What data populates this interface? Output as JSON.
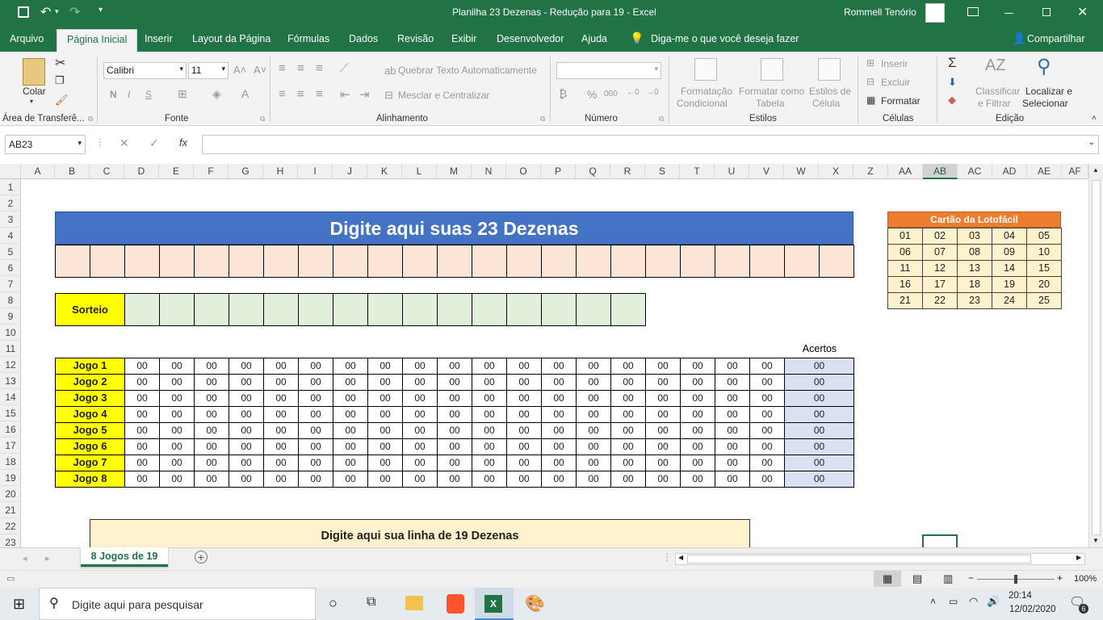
{
  "title": {
    "document": "Planilha 23 Dezenas - Redução para 19  -  Excel",
    "user": "Rommell Tenório"
  },
  "tabs": [
    "Arquivo",
    "Página Inicial",
    "Inserir",
    "Layout da Página",
    "Fórmulas",
    "Dados",
    "Revisão",
    "Exibir",
    "Desenvolvedor",
    "Ajuda"
  ],
  "tellme": "Diga-me o que você deseja fazer",
  "share": "Compartilhar",
  "ribbon": {
    "paste": "Colar",
    "clipboard": "Área de Transferê...",
    "font_name": "Calibri",
    "font_size": "11",
    "bold": "N",
    "italic": "I",
    "underline": "S",
    "font": "Fonte",
    "wrap": "Quebrar Texto Automaticamente",
    "merge": "Mesclar e Centralizar",
    "alignment": "Alinhamento",
    "number": "Número",
    "percent": "%",
    "thousands": "000",
    "cond_format": [
      "Formatação",
      "Condicional"
    ],
    "format_table": [
      "Formatar como",
      "Tabela"
    ],
    "cell_styles": [
      "Estilos de",
      "Célula"
    ],
    "styles": "Estilos",
    "insert": "Inserir",
    "delete": "Excluir",
    "format": "Formatar",
    "cells": "Células",
    "sort": [
      "Classificar",
      "e Filtrar"
    ],
    "find": [
      "Localizar e",
      "Selecionar"
    ],
    "editing": "Edição"
  },
  "namebox": "AB23",
  "columns": [
    "A",
    "B",
    "C",
    "D",
    "E",
    "F",
    "G",
    "H",
    "I",
    "J",
    "K",
    "L",
    "M",
    "N",
    "O",
    "P",
    "Q",
    "R",
    "S",
    "T",
    "U",
    "V",
    "W",
    "X",
    "Z",
    "AA",
    "AB",
    "AC",
    "AD",
    "AE",
    "AF"
  ],
  "rows": [
    "1",
    "2",
    "3",
    "4",
    "5",
    "6",
    "7",
    "8",
    "9",
    "10",
    "11",
    "12",
    "13",
    "14",
    "15",
    "16",
    "17",
    "18",
    "19",
    "20",
    "21",
    "22",
    "23"
  ],
  "sheet": {
    "header_title": "Digite aqui suas 23 Dezenas",
    "sorteio": "Sorteio",
    "acertos_label": "Acertos",
    "games": [
      {
        "label": "Jogo 1",
        "numbers": [
          "00",
          "00",
          "00",
          "00",
          "00",
          "00",
          "00",
          "00",
          "00",
          "00",
          "00",
          "00",
          "00",
          "00",
          "00",
          "00",
          "00",
          "00",
          "00"
        ],
        "hits": "00"
      },
      {
        "label": "Jogo 2",
        "numbers": [
          "00",
          "00",
          "00",
          "00",
          "00",
          "00",
          "00",
          "00",
          "00",
          "00",
          "00",
          "00",
          "00",
          "00",
          "00",
          "00",
          "00",
          "00",
          "00"
        ],
        "hits": "00"
      },
      {
        "label": "Jogo 3",
        "numbers": [
          "00",
          "00",
          "00",
          "00",
          "00",
          "00",
          "00",
          "00",
          "00",
          "00",
          "00",
          "00",
          "00",
          "00",
          "00",
          "00",
          "00",
          "00",
          "00"
        ],
        "hits": "00"
      },
      {
        "label": "Jogo 4",
        "numbers": [
          "00",
          "00",
          "00",
          "00",
          "00",
          "00",
          "00",
          "00",
          "00",
          "00",
          "00",
          "00",
          "00",
          "00",
          "00",
          "00",
          "00",
          "00",
          "00"
        ],
        "hits": "00"
      },
      {
        "label": "Jogo 5",
        "numbers": [
          "00",
          "00",
          "00",
          "00",
          "00",
          "00",
          "00",
          "00",
          "00",
          "00",
          "00",
          "00",
          "00",
          "00",
          "00",
          "00",
          "00",
          "00",
          "00"
        ],
        "hits": "00"
      },
      {
        "label": "Jogo 6",
        "numbers": [
          "00",
          "00",
          "00",
          "00",
          "00",
          "00",
          "00",
          "00",
          "00",
          "00",
          "00",
          "00",
          "00",
          "00",
          "00",
          "00",
          "00",
          "00",
          "00"
        ],
        "hits": "00"
      },
      {
        "label": "Jogo 7",
        "numbers": [
          "00",
          "00",
          "00",
          "00",
          "00",
          "00",
          "00",
          "00",
          "00",
          "00",
          "00",
          "00",
          "00",
          "00",
          "00",
          "00",
          "00",
          "00",
          "00"
        ],
        "hits": "00"
      },
      {
        "label": "Jogo 8",
        "numbers": [
          "00",
          "00",
          "00",
          "00",
          "00",
          "00",
          "00",
          "00",
          "00",
          "00",
          "00",
          "00",
          "00",
          "00",
          "00",
          "00",
          "00",
          "00",
          "00"
        ],
        "hits": "00"
      }
    ],
    "card_title": "Cartão da Lotofácil",
    "card_numbers": [
      [
        "01",
        "02",
        "03",
        "04",
        "05"
      ],
      [
        "06",
        "07",
        "08",
        "09",
        "10"
      ],
      [
        "11",
        "12",
        "13",
        "14",
        "15"
      ],
      [
        "16",
        "17",
        "18",
        "19",
        "20"
      ],
      [
        "21",
        "22",
        "23",
        "24",
        "25"
      ]
    ],
    "line19_title": "Digite aqui sua linha de 19 Dezenas"
  },
  "sheet_tab": "8 Jogos de 19",
  "zoom": "100%",
  "taskbar": {
    "search": "Digite aqui para pesquisar",
    "time": "20:14",
    "date": "12/02/2020",
    "notifications": "6"
  },
  "colors": {
    "excel_green": "#217346",
    "title_blue": "#4472c4",
    "salmon": "#fce4d6",
    "green_light": "#e2efda",
    "yellow": "#ffff00",
    "lavender": "#d9e1f2",
    "orange": "#ed7d31",
    "card_cell": "#fff2cc",
    "line19_bg": "#fff2cc"
  }
}
